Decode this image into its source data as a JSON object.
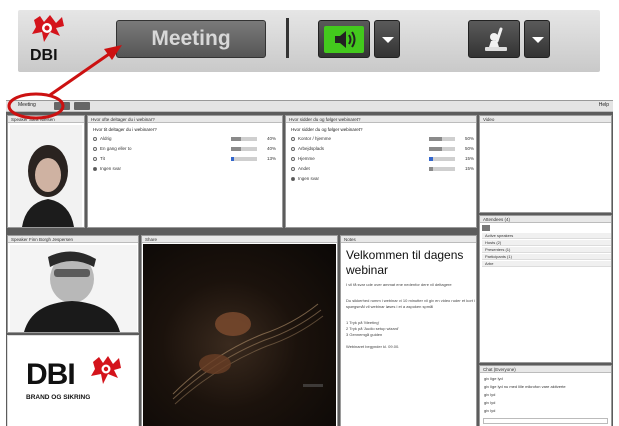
{
  "zoom_toolbar": {
    "logo_text": "DBI",
    "meeting_label": "Meeting",
    "icons": [
      "dbi-flame-logo",
      "speaker-icon",
      "raise-hand-icon",
      "chevron-down-icon"
    ],
    "colors": {
      "audio_green": "#43c91d",
      "annotation_red": "#cc1111"
    }
  },
  "app": {
    "menu": {
      "meeting": "Meeting",
      "help": "Help"
    },
    "pods": {
      "poll1": {
        "title": "Hvor ofte deltager du i webinar?",
        "question": "Hvor tit deltager du i webinarer?",
        "rows": [
          {
            "label": "Aldrig",
            "pct": "40%",
            "count": "16",
            "fill": 0.4,
            "selected": false
          },
          {
            "label": "En gang eller to",
            "pct": "40%",
            "count": "16",
            "fill": 0.4,
            "selected": false
          },
          {
            "label": "Tit",
            "pct": "13%",
            "count": "5",
            "fill": 0.13,
            "selected": false
          },
          {
            "label": "Ingen svar",
            "pct": "",
            "count": "",
            "fill": 0,
            "selected": true
          }
        ]
      },
      "poll2": {
        "title": "Hvor sidder du og følger webinaret?",
        "question": "Hvor sidder du og følger webinaret?",
        "rows": [
          {
            "label": "Kontor / hjemme",
            "pct": "50%",
            "count": "20",
            "fill": 0.5,
            "selected": false
          },
          {
            "label": "Arbejdsplads",
            "pct": "50%",
            "count": "20",
            "fill": 0.5,
            "selected": false
          },
          {
            "label": "Hjemme",
            "pct": "15%",
            "count": "6",
            "fill": 0.15,
            "selected": false
          },
          {
            "label": "Andet",
            "pct": "15%",
            "count": "6",
            "fill": 0.15,
            "selected": false
          },
          {
            "label": "Ingen svar",
            "pct": "",
            "count": "",
            "fill": 0,
            "selected": true
          }
        ]
      },
      "video": {
        "title": "Video"
      },
      "speaker1": {
        "title": "Speaker Sara Nielsen"
      },
      "speaker2": {
        "title": "Speaker Finn Borgh Jespersen"
      },
      "share": {
        "title": "Share"
      },
      "notes": {
        "title": "Notes",
        "heading": "Velkommen til dagens webinar",
        "body": [
          "I vil få svar ude over ammat ene nedenfor dere vil deltagere",
          "Du sikkerhed rumm i webinar vi 10 minutter vil giv en video ruder et kort i spørgsmål vil webinar løses i et a aspoken spmål",
          "1 Tryk på 'Meeting'",
          "2 Tryk på 'Audio setup wizard'",
          "3 Gennemgå guiden",
          "Webinaret begynder kl. 09.00."
        ]
      },
      "attendees": {
        "title": "Attendees (4)",
        "rows": [
          "Active speakers",
          "Hosts (2)",
          "Presenters (1)",
          "Participants (1)",
          "Arbe"
        ]
      },
      "chat": {
        "title": "Chat (Everyone)",
        "lines": [
          "giv lige lyd",
          "giv lige lyd nu med lille mikrofon vare aktiverte",
          "giv lyd",
          "giv lyd",
          "giv lyd"
        ]
      }
    },
    "brand": {
      "name": "DBI",
      "tagline": "BRAND OG SIKRING"
    }
  }
}
